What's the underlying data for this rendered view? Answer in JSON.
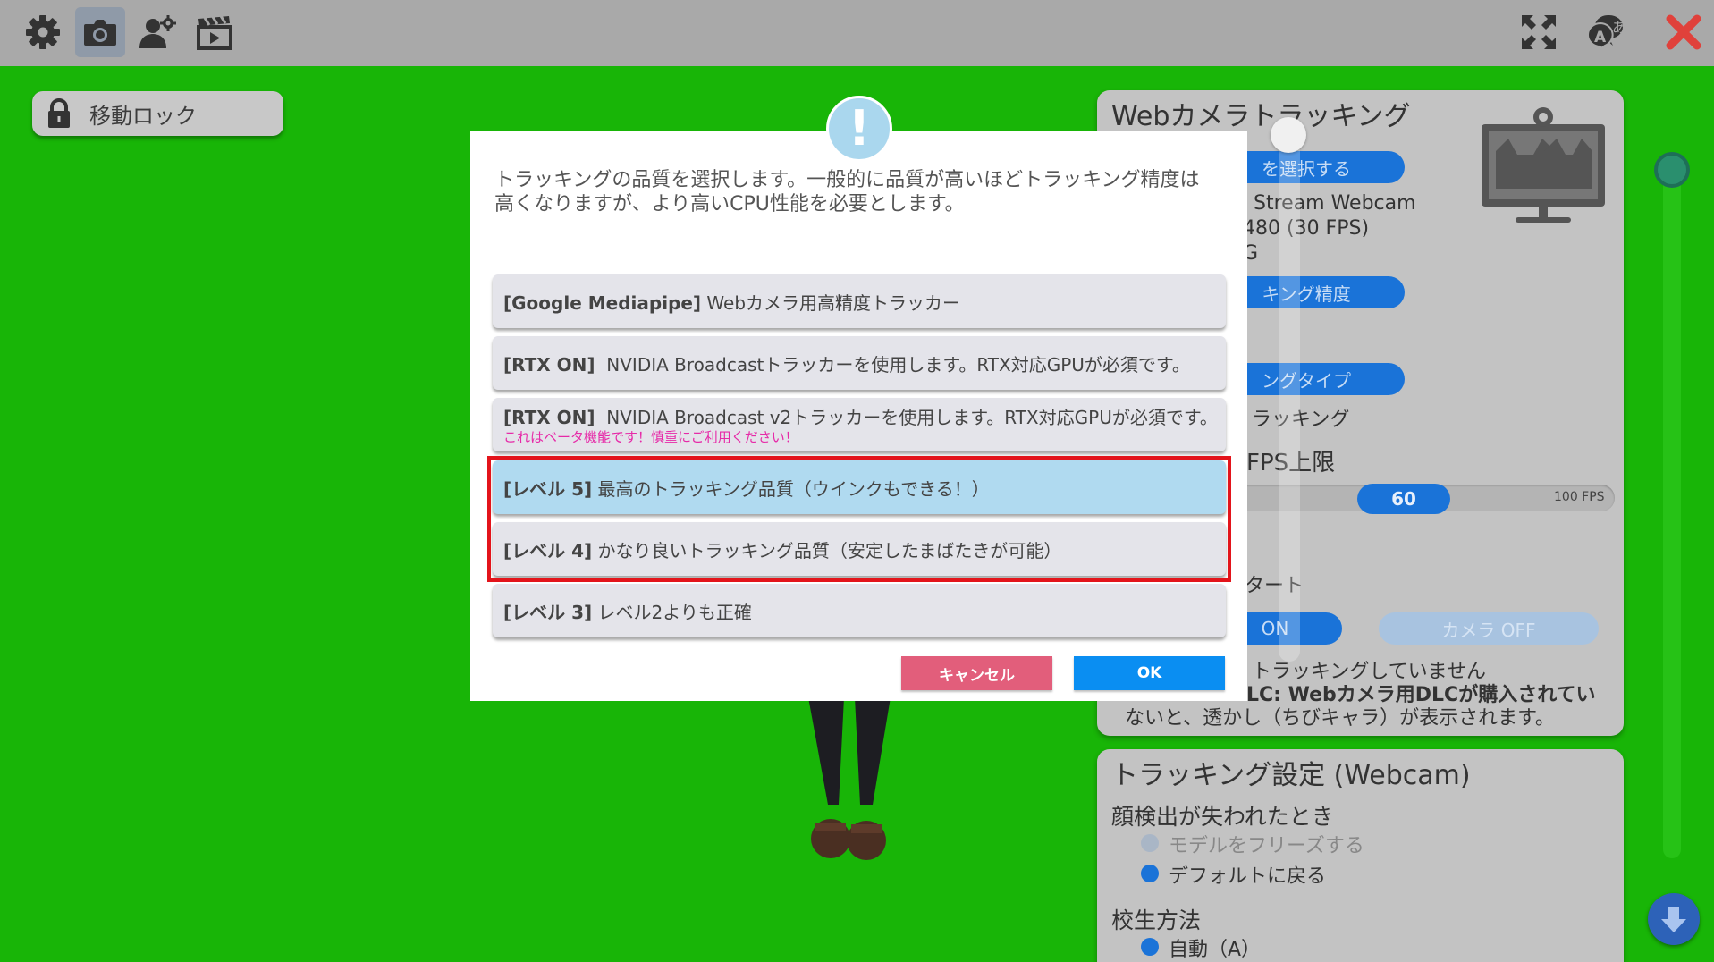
{
  "toolbar": {
    "settings_icon": "gear-icon",
    "camera_icon": "camera-icon",
    "avatar_icon": "user-gear-icon",
    "clapper_icon": "clapperboard-icon",
    "fullscreen_icon": "fullscreen-icon",
    "language_icon": "language-icon",
    "close_icon": "close-icon",
    "language_glyph_a": "A",
    "language_glyph_jp": "あ"
  },
  "lock_button": {
    "label": "移動ロック"
  },
  "right_panel": {
    "title": "Webカメラトラッキング",
    "select_camera_pill": "を選択する",
    "camera_name": "Stream Webcam",
    "resolution": "480 (30 FPS)",
    "format_suffix": "G",
    "accuracy_pill": "キング精度",
    "type_pill": "ングタイプ",
    "tracking_value": "ラッキング",
    "fps_label": "FPS上限",
    "fps_value": "60",
    "fps_max": "100 FPS",
    "start_label": "タート",
    "on_button": "ON",
    "camera_off_button": "カメラ OFF",
    "status_line": "トラッキングしていません",
    "dlc_line_1": "LC: Webカメラ用DLCが購入されてい",
    "dlc_line_2": "ないと、透かし（ちびキャラ）が表示されます。"
  },
  "settings_panel": {
    "title": "トラッキング設定 (Webcam)",
    "face_lost_label": "顔検出が失われたとき",
    "option_freeze": "モデルをフリーズする",
    "option_default": "デフォルトに戻る",
    "calibration_label": "校生方法",
    "option_auto": "自動（A）"
  },
  "dialog": {
    "message": "トラッキングの品質を選択します。一般的に品質が高いほどトラッキング精度は高くなりますが、より高いCPU性能を必要とします。",
    "options": [
      {
        "tag": "[Google Mediapipe]",
        "text": " Webカメラ用高精度トラッカー",
        "warning": ""
      },
      {
        "tag": "[RTX ON]",
        "text": "  NVIDIA Broadcastトラッカーを使用します。RTX対応GPUが必須です。",
        "warning": ""
      },
      {
        "tag": "[RTX ON]",
        "text": "  NVIDIA Broadcast v2トラッカーを使用します。RTX対応GPUが必須です。",
        "warning": "これはベータ機能です！慎重にご利用ください！"
      },
      {
        "tag": "[レベル 5]",
        "text": " 最高のトラッキング品質（ウインクもできる！）",
        "warning": ""
      },
      {
        "tag": "[レベル 4]",
        "text": " かなり良いトラッキング品質（安定したまばたきが可能）",
        "warning": ""
      },
      {
        "tag": "[レベル 3]",
        "text": " レベル2よりも正確",
        "warning": ""
      }
    ],
    "selected_index": 3,
    "cancel_label": "キャンセル",
    "ok_label": "OK",
    "alert_glyph": "!"
  },
  "colors": {
    "background": "#18b507",
    "accent_blue": "#1a73d8",
    "selected_option": "#b0daf0",
    "cancel": "#e25e7b",
    "ok": "#0a8ef2",
    "highlight": "#e3141b",
    "warning_text": "#e62aa8"
  }
}
